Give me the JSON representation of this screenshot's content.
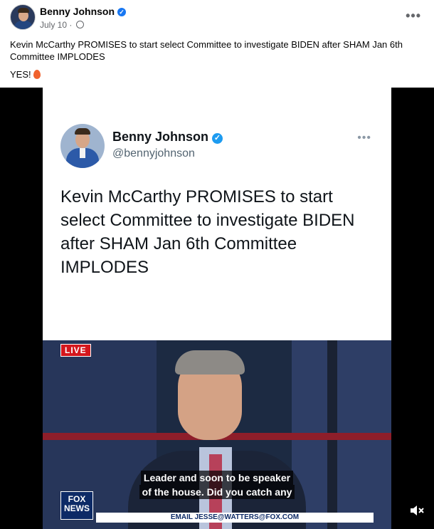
{
  "post": {
    "author": "Benny Johnson",
    "date": "July 10",
    "date_sep": " · ",
    "text": "Kevin McCarthy PROMISES to start select Committee to investigate BIDEN after SHAM Jan 6th Committee IMPLODES",
    "reaction_line": "YES!",
    "verified_icon": "verified-badge-icon",
    "more_icon": "more-options-icon",
    "privacy_icon": "globe-icon",
    "more_glyph": "•••"
  },
  "tweet": {
    "name": "Benny Johnson",
    "handle": "@bennyjohnson",
    "text": "Kevin McCarthy PROMISES to start select Committee to investigate BIDEN after SHAM Jan 6th Committee IMPLODES",
    "more_glyph": "•••"
  },
  "video": {
    "live_label": "LIVE",
    "caption_line1": "Leader and soon to be speaker",
    "caption_line2": "of the house. Did you catch any",
    "logo_text_top": "FOX",
    "logo_text_bottom": "NEWS",
    "ticker_text": "EMAIL JESSE@WATTERS@FOX.COM",
    "mute_icon": "speaker-muted-icon"
  },
  "colors": {
    "accent": "#1877f2",
    "twitter_blue": "#1d9bf0",
    "live_red": "#d4161c"
  }
}
